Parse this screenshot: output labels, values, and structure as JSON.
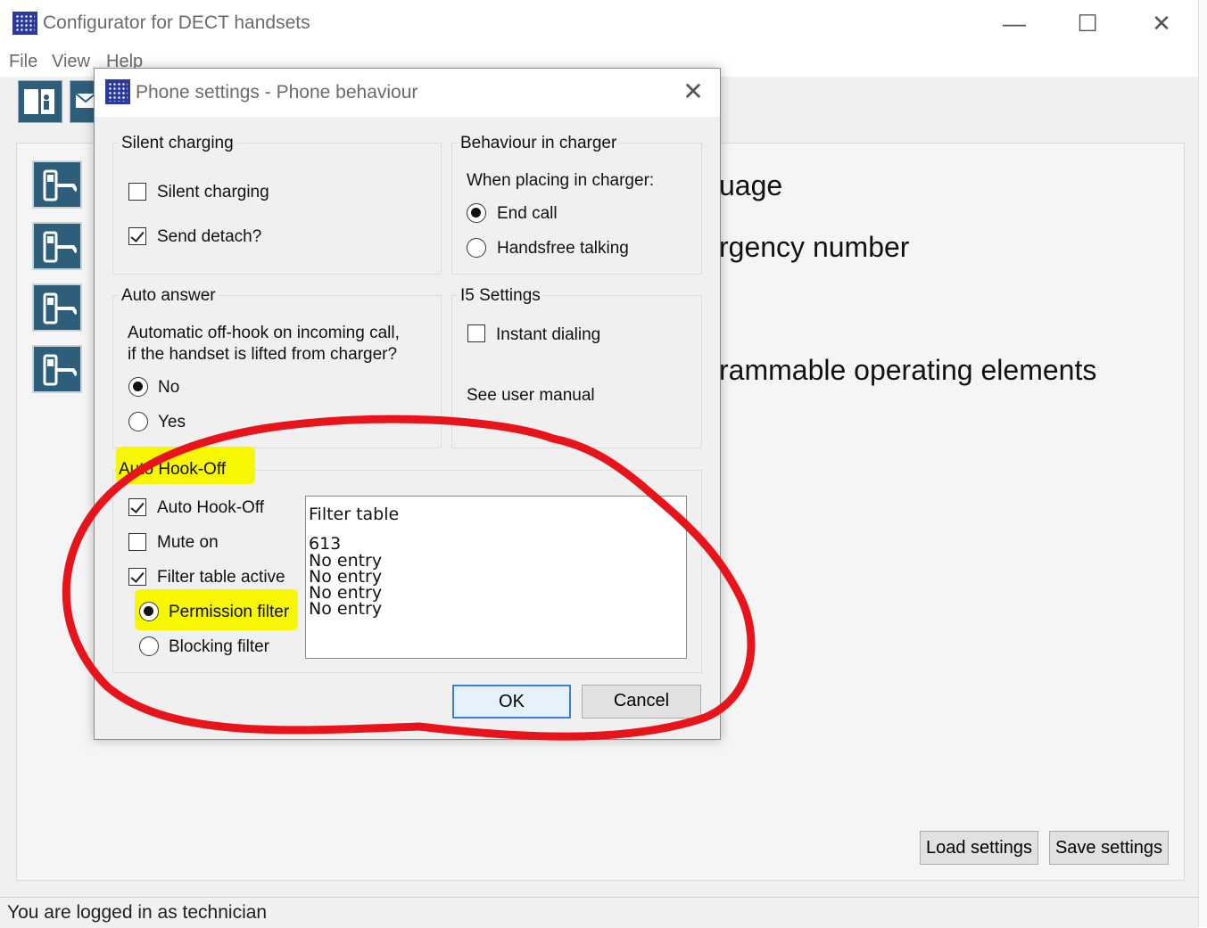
{
  "app": {
    "title": "Configurator for DECT handsets",
    "window_controls": {
      "minimize": "—",
      "maximize": "☐",
      "close": "✕"
    },
    "menu": [
      "File",
      "View",
      "Help"
    ]
  },
  "background": {
    "headings": [
      "uage",
      "rgency number",
      "rammable operating elements"
    ],
    "load_button": "Load settings",
    "save_button": "Save settings"
  },
  "status": {
    "text": "You are logged in as technician"
  },
  "dialog": {
    "title": "Phone settings - Phone behaviour",
    "close": "✕",
    "silent_charging": {
      "title": "Silent charging",
      "silent_charging_label": "Silent charging",
      "silent_charging_checked": false,
      "send_detach_label": "Send detach?",
      "send_detach_checked": true
    },
    "behaviour_in_charger": {
      "title": "Behaviour in charger",
      "prompt": "When placing in charger:",
      "options": [
        "End call",
        "Handsfree talking"
      ],
      "selected": "End call"
    },
    "auto_answer": {
      "title": "Auto answer",
      "description_line1": "Automatic off-hook on incoming call,",
      "description_line2": "if the handset is lifted from charger?",
      "options": [
        "No",
        "Yes"
      ],
      "selected": "No"
    },
    "i5_settings": {
      "title": "I5 Settings",
      "instant_dialing_label": "Instant dialing",
      "instant_dialing_checked": false,
      "note": "See user manual"
    },
    "auto_hook_off": {
      "title": "Auto Hook-Off",
      "auto_hook_off_label": "Auto Hook-Off",
      "auto_hook_off_checked": true,
      "mute_on_label": "Mute on",
      "mute_on_checked": false,
      "filter_table_active_label": "Filter table active",
      "filter_table_active_checked": true,
      "filter_options": [
        "Permission filter",
        "Blocking filter"
      ],
      "filter_selected": "Permission filter",
      "filter_table": {
        "header": "Filter table",
        "rows": [
          "613",
          "No entry",
          "No entry",
          "No entry",
          "No entry"
        ]
      }
    },
    "ok_button": "OK",
    "cancel_button": "Cancel"
  },
  "colors": {
    "annotation_circle": "#e8141b",
    "highlight": "#f7f700",
    "ok_button_border": "#3b7fd4",
    "tool_icon_bg": "#2e5f7a"
  }
}
